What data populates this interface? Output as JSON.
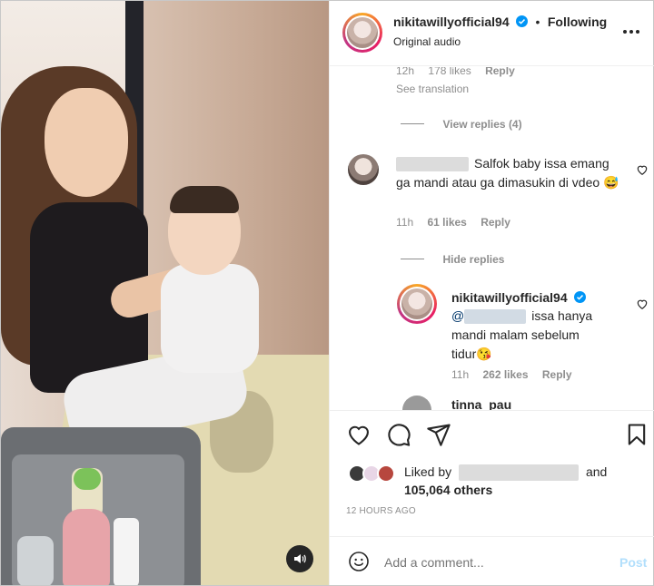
{
  "post": {
    "username": "nikitawillyofficial94",
    "separator": "•",
    "follow_label": "Following",
    "audio_label": "Original audio"
  },
  "comments": {
    "prev_meta": {
      "time": "12h",
      "likes": "178 likes",
      "reply": "Reply"
    },
    "see_translation": "See translation",
    "view_replies": "View replies (4)",
    "comment1": {
      "text": "Salfok baby issa emang ga mandi atau ga dimasukin di vdeo 😅",
      "time": "11h",
      "likes": "61 likes",
      "reply": "Reply"
    },
    "hide_replies": "Hide replies",
    "reply1": {
      "username": "nikitawillyofficial94",
      "mention": "@",
      "text": "issa hanya mandi malam sebelum tidur😘",
      "time": "11h",
      "likes": "262 likes",
      "reply": "Reply"
    },
    "partial_name": "tinna_pau"
  },
  "actions": {
    "liked_by_prefix": "Liked by",
    "liked_by_and": "and",
    "others": "105,064 others",
    "timestamp": "12 HOURS AGO"
  },
  "composer": {
    "placeholder": "Add a comment...",
    "post_label": "Post"
  },
  "icons": {
    "verified": "verified-badge-icon",
    "more": "more-options-icon",
    "like": "heart-icon",
    "comment": "comment-bubble-icon",
    "share": "paper-plane-icon",
    "save": "bookmark-icon",
    "emoji": "emoji-icon",
    "sound": "speaker-icon"
  },
  "colors": {
    "text": "#262626",
    "muted": "#8e8e8e",
    "verified": "#0095f6",
    "post_disabled": "#b2dffc"
  }
}
